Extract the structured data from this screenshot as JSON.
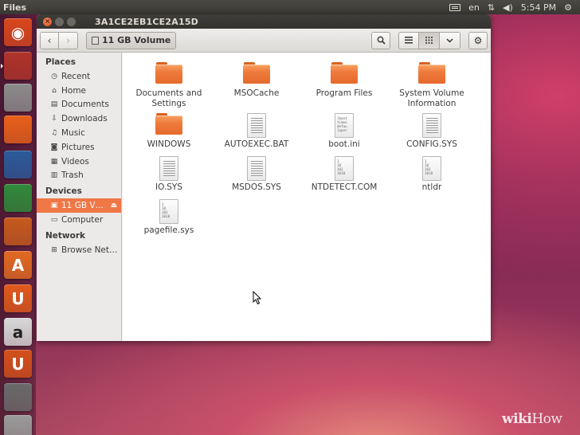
{
  "top_panel": {
    "app_title": "Files",
    "lang": "en",
    "clock": "5:54 PM"
  },
  "launcher": {
    "items": [
      {
        "name": "dash-home",
        "glyph": "◉",
        "color": "#d9471d"
      },
      {
        "name": "files-app",
        "glyph": "",
        "color": "#b0342a"
      },
      {
        "name": "file-cabinet",
        "glyph": "",
        "color": "#8c8c8c"
      },
      {
        "name": "firefox",
        "glyph": "",
        "color": "#e8601a"
      },
      {
        "name": "libreoffice-writer",
        "glyph": "",
        "color": "#2a5a9a"
      },
      {
        "name": "libreoffice-calc",
        "glyph": "",
        "color": "#2f8a3a"
      },
      {
        "name": "libreoffice-impress",
        "glyph": "",
        "color": "#c65a1e"
      },
      {
        "name": "software-center",
        "glyph": "A",
        "color": "#e26a22"
      },
      {
        "name": "ubuntu-one",
        "glyph": "U",
        "color": "#e05a1c"
      },
      {
        "name": "amazon",
        "glyph": "a",
        "color": "#d8d8d8"
      },
      {
        "name": "ubuntu-one-music",
        "glyph": "U",
        "color": "#d4501a"
      },
      {
        "name": "system-settings",
        "glyph": "",
        "color": "#6a6a6a"
      },
      {
        "name": "drive",
        "glyph": "",
        "color": "#9a9a9a"
      }
    ]
  },
  "window": {
    "title": "3A1CE2EB1CE2A15D",
    "path_button": "11 GB Volume"
  },
  "sidebar": {
    "places_heading": "Places",
    "places": [
      {
        "label": "Recent",
        "icon": "clock-icon"
      },
      {
        "label": "Home",
        "icon": "home-icon"
      },
      {
        "label": "Documents",
        "icon": "document-icon"
      },
      {
        "label": "Downloads",
        "icon": "download-icon"
      },
      {
        "label": "Music",
        "icon": "music-icon"
      },
      {
        "label": "Pictures",
        "icon": "camera-icon"
      },
      {
        "label": "Videos",
        "icon": "film-icon"
      },
      {
        "label": "Trash",
        "icon": "trash-icon"
      }
    ],
    "devices_heading": "Devices",
    "devices": [
      {
        "label": "11 GB V…",
        "icon": "drive-icon",
        "selected": true
      },
      {
        "label": "Computer",
        "icon": "computer-icon",
        "selected": false
      }
    ],
    "network_heading": "Network",
    "network": [
      {
        "label": "Browse Net…",
        "icon": "network-icon"
      }
    ]
  },
  "files": [
    {
      "label": "Documents and Settings",
      "kind": "folder"
    },
    {
      "label": "MSOCache",
      "kind": "folder"
    },
    {
      "label": "Program Files",
      "kind": "folder"
    },
    {
      "label": "System Volume Information",
      "kind": "folder"
    },
    {
      "label": "WINDOWS",
      "kind": "folder"
    },
    {
      "label": "AUTOEXEC.BAT",
      "kind": "text"
    },
    {
      "label": "boot.ini",
      "kind": "preview",
      "preview": "[boot\ntimeo\ndefau\n[oper"
    },
    {
      "label": "CONFIG.SYS",
      "kind": "text"
    },
    {
      "label": "IO.SYS",
      "kind": "text"
    },
    {
      "label": "MSDOS.SYS",
      "kind": "text"
    },
    {
      "label": "NTDETECT.COM",
      "kind": "binary",
      "preview": "1\n10\n101\n1010"
    },
    {
      "label": "ntldr",
      "kind": "binary",
      "preview": "1\n10\n101\n1010"
    },
    {
      "label": "pagefile.sys",
      "kind": "binary",
      "preview": "1\n10\n101\n1010"
    }
  ],
  "watermark": {
    "wiki": "wiki",
    "how": "How"
  }
}
